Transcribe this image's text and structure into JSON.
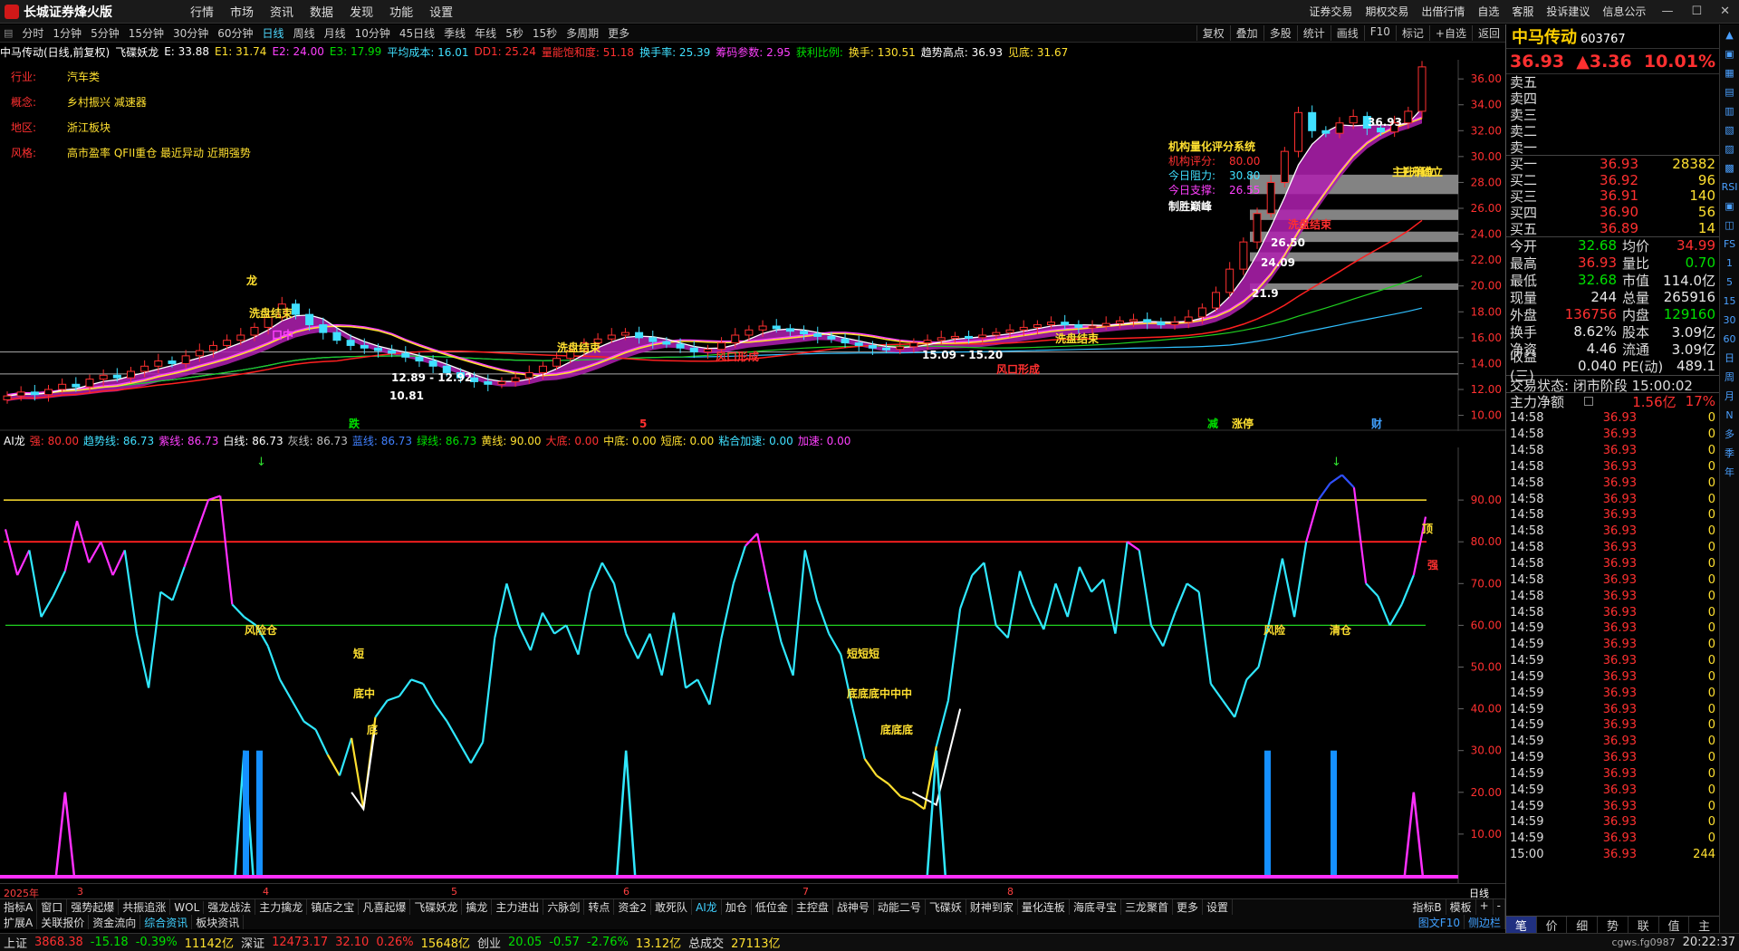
{
  "app": {
    "title": "长城证券烽火版"
  },
  "menu": [
    "行情",
    "市场",
    "资讯",
    "数据",
    "发现",
    "功能",
    "设置"
  ],
  "top_right": [
    "证券交易",
    "期权交易",
    "出借行情",
    "自选",
    "客服",
    "投诉建议",
    "信息公示"
  ],
  "periods": [
    "分时",
    "1分钟",
    "5分钟",
    "15分钟",
    "30分钟",
    "60分钟",
    "日线",
    "周线",
    "月线",
    "10分钟",
    "45日线",
    "季线",
    "年线",
    "5秒",
    "15秒",
    "多周期",
    "更多"
  ],
  "active_period": "日线",
  "period_right": [
    "复权",
    "叠加",
    "多股",
    "统计",
    "画线",
    "F10",
    "标记",
    "+自选",
    "返回"
  ],
  "info_bar": [
    {
      "t": "中马传动(日线,前复权)",
      "c": "#ffffff"
    },
    {
      "t": "飞碟妖龙",
      "c": "#ffffff"
    },
    {
      "t": "E: 33.88",
      "c": "#ffffff"
    },
    {
      "t": "E1: 31.74",
      "c": "#ffe030"
    },
    {
      "t": "E2: 24.00",
      "c": "#ff40ff"
    },
    {
      "t": "E3: 17.99",
      "c": "#00e000"
    },
    {
      "t": "平均成本: 16.01",
      "c": "#40e0ff"
    },
    {
      "t": "DD1: 25.24",
      "c": "#ff3030"
    },
    {
      "t": "量能饱和度: 51.18",
      "c": "#ff3030"
    },
    {
      "t": "换手率: 25.39",
      "c": "#40e0ff"
    },
    {
      "t": "筹码参数: 2.95",
      "c": "#ff40ff"
    },
    {
      "t": "获利比例:",
      "c": "#00e000"
    },
    {
      "t": "换手: 130.51",
      "c": "#ffe030"
    },
    {
      "t": "趋势高点: 36.93",
      "c": "#ffffff"
    },
    {
      "t": "见底: 31.67",
      "c": "#ffe030"
    }
  ],
  "stock_info": [
    {
      "k": "行业:",
      "v": "汽车类"
    },
    {
      "k": "概念:",
      "v": "乡村振兴 减速器"
    },
    {
      "k": "地区:",
      "v": "浙江板块"
    },
    {
      "k": "风格:",
      "v": "高市盈率 QFII重仓 最近异动 近期强势"
    }
  ],
  "main_chart": {
    "y_ticks": [
      36,
      34,
      32,
      30,
      28,
      26,
      24,
      22,
      20,
      18,
      16,
      14,
      12,
      10
    ],
    "candles_close": [
      11.5,
      11.8,
      11.6,
      12.0,
      12.4,
      12.2,
      12.8,
      13.1,
      12.9,
      13.4,
      13.8,
      14.2,
      14.0,
      14.6,
      15.0,
      15.4,
      15.8,
      16.2,
      16.8,
      17.6,
      18.6,
      17.8,
      17.0,
      16.4,
      15.8,
      15.4,
      15.2,
      15.0,
      14.8,
      14.5,
      14.2,
      13.8,
      13.3,
      12.9,
      12.6,
      12.4,
      12.6,
      12.9,
      13.3,
      13.8,
      14.4,
      15.0,
      15.6,
      15.9,
      16.2,
      16.4,
      16.0,
      15.7,
      15.5,
      15.2,
      14.9,
      15.1,
      15.6,
      16.2,
      16.6,
      16.9,
      16.7,
      16.5,
      16.3,
      16.1,
      15.9,
      15.6,
      15.4,
      15.2,
      15.1,
      15.3,
      15.6,
      15.8,
      16.0,
      16.1,
      16.0,
      16.2,
      16.4,
      16.6,
      16.8,
      17.0,
      17.2,
      17.0,
      16.8,
      16.9,
      17.1,
      17.3,
      17.4,
      17.2,
      17.0,
      17.2,
      17.6,
      18.3,
      19.5,
      21.3,
      23.4,
      25.6,
      28.0,
      30.4,
      33.4,
      32.0,
      31.8,
      32.6,
      33.1,
      32.2,
      31.9,
      32.6,
      33.5,
      36.93
    ],
    "labels": [
      {
        "t": "龙",
        "c": "#ffe030"
      },
      {
        "t": "洗盘结束",
        "c": "#ffe030"
      },
      {
        "t": "口中",
        "c": "#ff40ff"
      },
      {
        "t": "12.89 - 12.92",
        "c": "#ffffff"
      },
      {
        "t": "10.81",
        "c": "#ffffff"
      },
      {
        "t": "洗盘结束",
        "c": "#ffe030"
      },
      {
        "t": "风口形成",
        "c": "#ff3030"
      },
      {
        "t": "15.09 - 15.20",
        "c": "#ffffff"
      },
      {
        "t": "风口形成",
        "c": "#ff3030"
      },
      {
        "t": "洗盘结束",
        "c": "#ffe030"
      },
      {
        "t": "21.9",
        "c": "#ffffff"
      },
      {
        "t": "24.09",
        "c": "#ffffff"
      },
      {
        "t": "26.50",
        "c": "#ffffff"
      },
      {
        "t": "洗盘结束",
        "c": "#ff3030"
      },
      {
        "t": "36.93",
        "c": "#ffffff"
      },
      {
        "t": "主升确立",
        "c": "#ffe030"
      },
      {
        "t": "主升确立",
        "c": "#ffe030"
      },
      {
        "t": "跌",
        "c": "#00e000"
      },
      {
        "t": "5",
        "c": "#ff3030"
      },
      {
        "t": "减",
        "c": "#00e000"
      },
      {
        "t": "涨停",
        "c": "#ffe030"
      },
      {
        "t": "财",
        "c": "#40a0ff"
      }
    ],
    "score_box": {
      "title": "机构量化评分系统",
      "lines": [
        {
          "k": "机构评分:",
          "v": "80.00",
          "c": "#ff3030"
        },
        {
          "k": "今日阻力:",
          "v": "30.80",
          "c": "#40e0ff"
        },
        {
          "k": "今日支撑:",
          "v": "26.55",
          "c": "#ff40ff"
        }
      ],
      "footer": "制胜巅峰"
    }
  },
  "indicator": {
    "header": [
      {
        "t": "AI龙",
        "c": "#ffffff"
      },
      {
        "t": "强: 80.00",
        "c": "#ff3030"
      },
      {
        "t": "趋势线: 86.73",
        "c": "#40e0ff"
      },
      {
        "t": "紫线: 86.73",
        "c": "#ff40ff"
      },
      {
        "t": "白线: 86.73",
        "c": "#ffffff"
      },
      {
        "t": "灰线: 86.73",
        "c": "#c0c0c0"
      },
      {
        "t": "蓝线: 86.73",
        "c": "#4080ff"
      },
      {
        "t": "绿线: 86.73",
        "c": "#00e000"
      },
      {
        "t": "黄线: 90.00",
        "c": "#ffe030"
      },
      {
        "t": "大底: 0.00",
        "c": "#ff3030"
      },
      {
        "t": "中底: 0.00",
        "c": "#ffe030"
      },
      {
        "t": "短底: 0.00",
        "c": "#ffe030"
      },
      {
        "t": "粘合加速: 0.00",
        "c": "#40e0ff"
      },
      {
        "t": "加速: 0.00",
        "c": "#ff40ff"
      }
    ],
    "y_ticks": [
      90,
      80,
      70,
      60,
      50,
      40,
      30,
      20,
      10
    ],
    "series": [
      83,
      72,
      78,
      62,
      67,
      73,
      85,
      75,
      80,
      72,
      78,
      58,
      45,
      68,
      66,
      74,
      82,
      90,
      91,
      65,
      62,
      60,
      55,
      47,
      42,
      37,
      35,
      29,
      24,
      33,
      16,
      38,
      42,
      43,
      47,
      46,
      41,
      37,
      32,
      27,
      32,
      57,
      70,
      60,
      54,
      63,
      58,
      60,
      53,
      68,
      75,
      70,
      58,
      52,
      58,
      48,
      63,
      45,
      47,
      41,
      57,
      70,
      79,
      82,
      68,
      56,
      48,
      78,
      66,
      58,
      53,
      40,
      28,
      24,
      22,
      19,
      18,
      16,
      31,
      42,
      64,
      72,
      75,
      60,
      57,
      73,
      65,
      59,
      70,
      62,
      74,
      68,
      71,
      58,
      80,
      78,
      60,
      55,
      63,
      70,
      68,
      46,
      42,
      38,
      47,
      50,
      62,
      76,
      62,
      80,
      90,
      94,
      96,
      93,
      70,
      67,
      60,
      65,
      72,
      86
    ],
    "labels": [
      {
        "t": "风险仓",
        "c": "#ffe030"
      },
      {
        "t": "短",
        "c": "#ffe030"
      },
      {
        "t": "底中",
        "c": "#ffe030"
      },
      {
        "t": "底",
        "c": "#ffe030"
      },
      {
        "t": "短短短",
        "c": "#ffe030"
      },
      {
        "t": "底底底中中中",
        "c": "#ffe030"
      },
      {
        "t": "底底底",
        "c": "#ffe030"
      },
      {
        "t": "风险",
        "c": "#ffe030"
      },
      {
        "t": "清仓",
        "c": "#ffe030"
      },
      {
        "t": "顶",
        "c": "#ffe030"
      },
      {
        "t": "强",
        "c": "#ff3030"
      }
    ]
  },
  "date_axis": [
    {
      "t": "2025年",
      "x": 4
    },
    {
      "t": "3",
      "x": 85
    },
    {
      "t": "4",
      "x": 290
    },
    {
      "t": "5",
      "x": 498
    },
    {
      "t": "6",
      "x": 688
    },
    {
      "t": "7",
      "x": 886
    },
    {
      "t": "8",
      "x": 1112
    }
  ],
  "tabs1": [
    "指标A",
    "窗口",
    "强势起爆",
    "共振追涨",
    "WOL",
    "强龙战法",
    "主力擒龙",
    "镇店之宝",
    "凡喜起爆",
    "飞碟妖龙",
    "擒龙",
    "主力进出",
    "六脉剑",
    "转点",
    "资金2",
    "敢死队",
    "AI龙",
    "加仓",
    "低位金",
    "主控盘",
    "战神号",
    "动能二号",
    "飞碟妖",
    "财神到家",
    "量化连板",
    "海底寻宝",
    "三龙聚首",
    "更多",
    "设置"
  ],
  "tabs1_active": "AI龙",
  "tabs1_right": [
    "指标B",
    "模板",
    "+",
    "-"
  ],
  "tabs2": [
    "扩展A",
    "关联报价",
    "资金流向",
    "综合资讯",
    "板块资讯"
  ],
  "tabs2_active": "综合资讯",
  "tabs2_right": [
    "图文F10",
    "侧边栏"
  ],
  "status": [
    {
      "t": "上证",
      "c": "#ddd"
    },
    {
      "t": "3868.38",
      "c": "#ff3030"
    },
    {
      "t": "-15.18",
      "c": "#00e000"
    },
    {
      "t": "-0.39%",
      "c": "#00e000"
    },
    {
      "t": "11142亿",
      "c": "#ffe030"
    },
    {
      "t": "深证",
      "c": "#ddd"
    },
    {
      "t": "12473.17",
      "c": "#ff3030"
    },
    {
      "t": "32.10",
      "c": "#ff3030"
    },
    {
      "t": "0.26%",
      "c": "#ff3030"
    },
    {
      "t": "15648亿",
      "c": "#ffe030"
    },
    {
      "t": "创业",
      "c": "#ddd"
    },
    {
      "t": "20.05",
      "c": "#00e000"
    },
    {
      "t": "-0.57",
      "c": "#00e000"
    },
    {
      "t": "-2.76%",
      "c": "#00e000"
    },
    {
      "t": "13.12亿",
      "c": "#ffe030"
    },
    {
      "t": "总成交",
      "c": "#ddd"
    },
    {
      "t": "27113亿",
      "c": "#ffe030"
    },
    {
      "t": "cgws.fg0987",
      "c": "#aaa"
    },
    {
      "t": "20:22:37",
      "c": "#ddd"
    }
  ],
  "quote": {
    "name": "中马传动",
    "code": "603767",
    "price": "36.93",
    "change": "▲3.36",
    "pct": "10.01%",
    "asks": [
      {
        "l": "卖五",
        "p": "",
        "v": ""
      },
      {
        "l": "卖四",
        "p": "",
        "v": ""
      },
      {
        "l": "卖三",
        "p": "",
        "v": ""
      },
      {
        "l": "卖二",
        "p": "",
        "v": ""
      },
      {
        "l": "卖一",
        "p": "",
        "v": ""
      }
    ],
    "bids": [
      {
        "l": "买一",
        "p": "36.93",
        "v": "28382"
      },
      {
        "l": "买二",
        "p": "36.92",
        "v": "96"
      },
      {
        "l": "买三",
        "p": "36.91",
        "v": "140"
      },
      {
        "l": "买四",
        "p": "36.90",
        "v": "56"
      },
      {
        "l": "买五",
        "p": "36.89",
        "v": "14"
      }
    ],
    "stats": [
      {
        "k": "今开",
        "v": "32.68",
        "vc": "grn",
        "k2": "均价",
        "v2": "34.99",
        "v2c": "red"
      },
      {
        "k": "最高",
        "v": "36.93",
        "vc": "red",
        "k2": "量比",
        "v2": "0.70",
        "v2c": "grn"
      },
      {
        "k": "最低",
        "v": "32.68",
        "vc": "grn",
        "k2": "市值",
        "v2": "114.0亿",
        "v2c": "wht"
      },
      {
        "k": "现量",
        "v": "244",
        "vc": "wht",
        "k2": "总量",
        "v2": "265916",
        "v2c": "wht"
      },
      {
        "k": "外盘",
        "v": "136756",
        "vc": "red",
        "k2": "内盘",
        "v2": "129160",
        "v2c": "grn"
      },
      {
        "k": "换手",
        "v": "8.62%",
        "vc": "wht",
        "k2": "股本",
        "v2": "3.09亿",
        "v2c": "wht"
      },
      {
        "k": "净资",
        "v": "4.46",
        "vc": "wht",
        "k2": "流通",
        "v2": "3.09亿",
        "v2c": "wht"
      },
      {
        "k": "收益(三)",
        "v": "0.040",
        "vc": "wht",
        "k2": "PE(动)",
        "v2": "489.1",
        "v2c": "wht"
      }
    ],
    "trade_status": "交易状态: 闭市阶段 15:00:02",
    "net": {
      "k": "主力净额",
      "v": "1.56亿",
      "p": "17%"
    },
    "ticks": [
      {
        "t": "14:58",
        "p": "36.93",
        "v": "0"
      },
      {
        "t": "14:58",
        "p": "36.93",
        "v": "0"
      },
      {
        "t": "14:58",
        "p": "36.93",
        "v": "0"
      },
      {
        "t": "14:58",
        "p": "36.93",
        "v": "0"
      },
      {
        "t": "14:58",
        "p": "36.93",
        "v": "0"
      },
      {
        "t": "14:58",
        "p": "36.93",
        "v": "0"
      },
      {
        "t": "14:58",
        "p": "36.93",
        "v": "0"
      },
      {
        "t": "14:58",
        "p": "36.93",
        "v": "0"
      },
      {
        "t": "14:58",
        "p": "36.93",
        "v": "0"
      },
      {
        "t": "14:58",
        "p": "36.93",
        "v": "0"
      },
      {
        "t": "14:58",
        "p": "36.93",
        "v": "0"
      },
      {
        "t": "14:58",
        "p": "36.93",
        "v": "0"
      },
      {
        "t": "14:58",
        "p": "36.93",
        "v": "0"
      },
      {
        "t": "14:59",
        "p": "36.93",
        "v": "0"
      },
      {
        "t": "14:59",
        "p": "36.93",
        "v": "0"
      },
      {
        "t": "14:59",
        "p": "36.93",
        "v": "0"
      },
      {
        "t": "14:59",
        "p": "36.93",
        "v": "0"
      },
      {
        "t": "14:59",
        "p": "36.93",
        "v": "0"
      },
      {
        "t": "14:59",
        "p": "36.93",
        "v": "0"
      },
      {
        "t": "14:59",
        "p": "36.93",
        "v": "0"
      },
      {
        "t": "14:59",
        "p": "36.93",
        "v": "0"
      },
      {
        "t": "14:59",
        "p": "36.93",
        "v": "0"
      },
      {
        "t": "14:59",
        "p": "36.93",
        "v": "0"
      },
      {
        "t": "14:59",
        "p": "36.93",
        "v": "0"
      },
      {
        "t": "14:59",
        "p": "36.93",
        "v": "0"
      },
      {
        "t": "14:59",
        "p": "36.93",
        "v": "0"
      },
      {
        "t": "14:59",
        "p": "36.93",
        "v": "0"
      },
      {
        "t": "15:00",
        "p": "36.93",
        "v": "244"
      }
    ],
    "tabs": [
      "笔",
      "价",
      "细",
      "势",
      "联",
      "值",
      "主"
    ],
    "tabs_active": "笔"
  },
  "sidebar": [
    "▲",
    "▣",
    "▦",
    "▤",
    "▥",
    "▧",
    "▨",
    "▩",
    "RSI",
    "▣",
    "◫",
    "FS",
    "1",
    "5",
    "15",
    "30",
    "60",
    "日",
    "周",
    "月",
    "N",
    "多",
    "季",
    "年"
  ]
}
